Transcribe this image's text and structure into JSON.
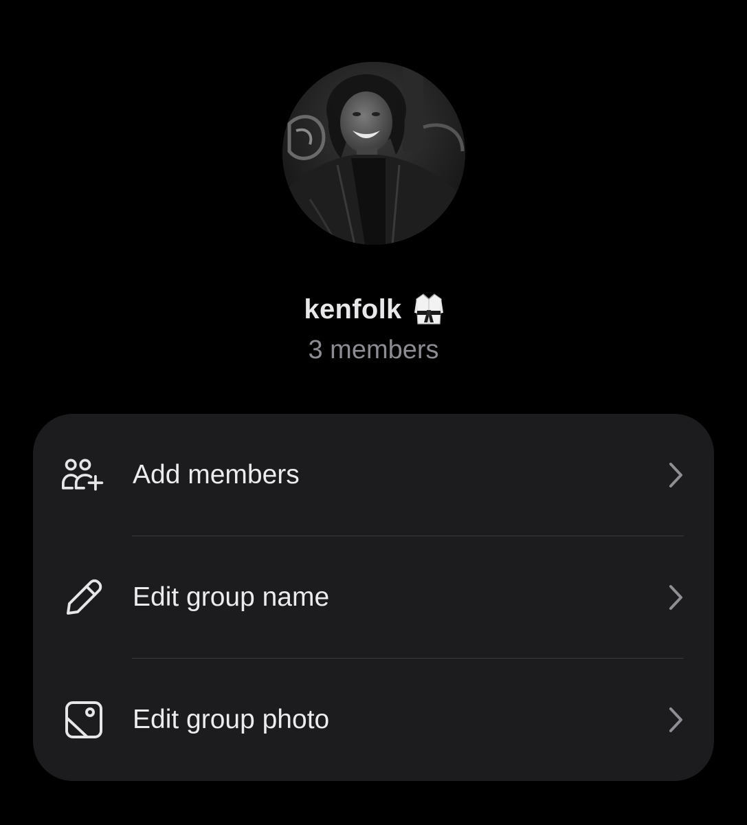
{
  "group": {
    "name": "kenfolk",
    "emoji_icon": "martial-arts-uniform-icon",
    "members_text": "3 members",
    "avatar_icon": "group-avatar-photo"
  },
  "menu": {
    "items": [
      {
        "label": "Add members",
        "icon": "add-members-icon"
      },
      {
        "label": "Edit group name",
        "icon": "pencil-icon"
      },
      {
        "label": "Edit group photo",
        "icon": "photo-icon"
      }
    ]
  },
  "colors": {
    "background": "#000000",
    "card": "#1c1c1e",
    "primary_text": "#ececee",
    "secondary_text": "#8c8c92",
    "chevron": "#8e8e93",
    "divider": "#3a3a3d"
  }
}
